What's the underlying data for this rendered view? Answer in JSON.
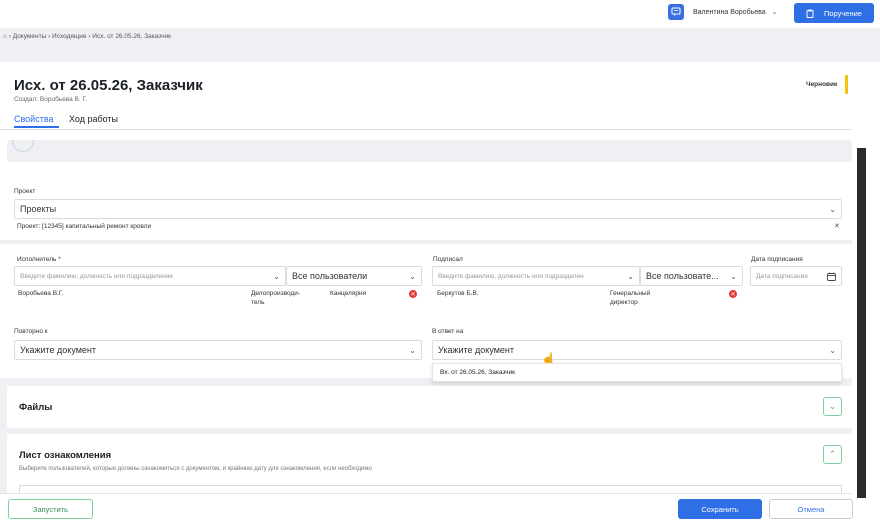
{
  "header": {
    "user_name": "Валентина Воробьева",
    "assign_label": "Поручение"
  },
  "breadcrumb": {
    "items": [
      "Документы",
      "Исходящие",
      "Исх. от 26.05.26, Заказчик"
    ]
  },
  "document": {
    "title": "Исх. от 26.05.26, Заказчик",
    "created_by": "Создал: Воробьева В. Г.",
    "status": "Черновик",
    "tabs": [
      "Свойства",
      "Ход работы"
    ]
  },
  "project": {
    "label": "Проект",
    "value": "Проекты",
    "selected": "Проект: [12345] капитальный ремонт кровли"
  },
  "executor": {
    "label": "Исполнитель *",
    "placeholder": "Введите фамилию, должность или подразделение",
    "filter": "Все пользователи",
    "person": "Воробьева В.Г.",
    "position_line1": "Делопроизводи-",
    "position_line2": "тель",
    "department": "Канцелярия"
  },
  "signer": {
    "label": "Подписал",
    "placeholder": "Введите фамилию, должность или подразделен",
    "filter": "Все пользовате...",
    "person": "Беркутов Б.В.",
    "position_line1": "Генеральный",
    "position_line2": "директор"
  },
  "sign_date": {
    "label": "Дата подписания",
    "placeholder": "Дата подписания"
  },
  "repeat_to": {
    "label": "Повторно к",
    "value": "Укажите документ"
  },
  "in_reply_to": {
    "label": "В ответ на",
    "value": "Укажите документ",
    "option": "Вх. от 26.05.26, Заказчик"
  },
  "files": {
    "title": "Файлы"
  },
  "review": {
    "title": "Лист ознакомления",
    "hint": "Выберите пользователей, которые должны ознакомиться с документом, и крайнюю дату для ознакомления, если необходимо"
  },
  "footer": {
    "start_label": "Запустить",
    "save_label": "Сохранить",
    "cancel_label": "Отмена"
  },
  "colors": {
    "accent": "#2f6fe6",
    "draft": "#f1c40f",
    "success": "#46b36a",
    "danger": "#e53935"
  }
}
